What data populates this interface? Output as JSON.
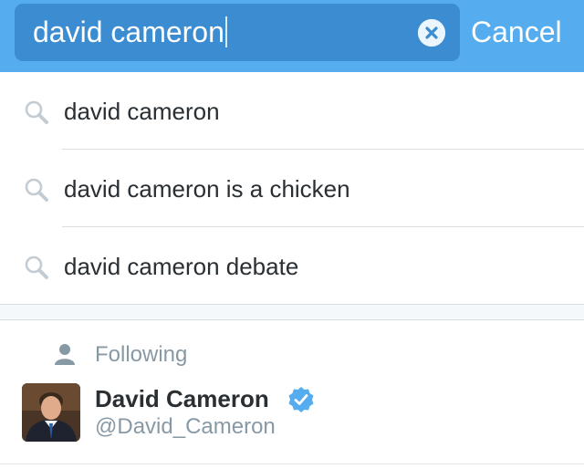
{
  "search": {
    "query": "david cameron",
    "cancel_label": "Cancel",
    "clear_icon": "clear-icon"
  },
  "suggestions": [
    {
      "label": "david cameron",
      "icon": "search-icon"
    },
    {
      "label": "david cameron is a chicken",
      "icon": "search-icon"
    },
    {
      "label": "david cameron debate",
      "icon": "search-icon"
    }
  ],
  "following": {
    "header_label": "Following",
    "header_icon": "person-icon",
    "user": {
      "name": "David Cameron",
      "handle": "@David_Cameron",
      "verified": true,
      "verified_icon": "verified-badge-icon"
    }
  },
  "colors": {
    "accent": "#55acee",
    "search_field": "#3b8cd0",
    "text_primary": "#292f33",
    "text_secondary": "#8899a6",
    "verified": "#55acee"
  }
}
